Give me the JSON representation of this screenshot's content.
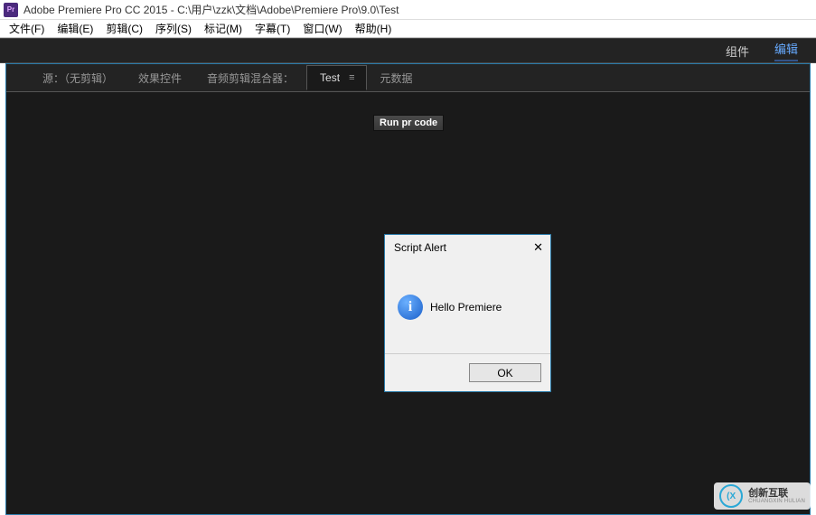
{
  "title_bar": {
    "app_icon_text": "Pr",
    "title": "Adobe Premiere Pro CC 2015 - C:\\用户\\zzk\\文档\\Adobe\\Premiere Pro\\9.0\\Test"
  },
  "menu": {
    "file": "文件(F)",
    "edit": "编辑(E)",
    "clip": "剪辑(C)",
    "sequence": "序列(S)",
    "marker": "标记(M)",
    "title": "字幕(T)",
    "window": "窗口(W)",
    "help": "帮助(H)"
  },
  "workspace": {
    "component": "组件",
    "edit": "编辑"
  },
  "panel_tabs": {
    "source": "源：（无剪辑）",
    "effect": "效果控件",
    "mixer": "音频剪辑混合器：",
    "test": "Test",
    "metadata": "元数据"
  },
  "panel_content": {
    "run_button": "Run pr code"
  },
  "dialog": {
    "title": "Script Alert",
    "message": "Hello Premiere",
    "ok": "OK"
  },
  "watermark": {
    "main": "创新互联",
    "sub": "CHUANGXIN HULIAN"
  }
}
